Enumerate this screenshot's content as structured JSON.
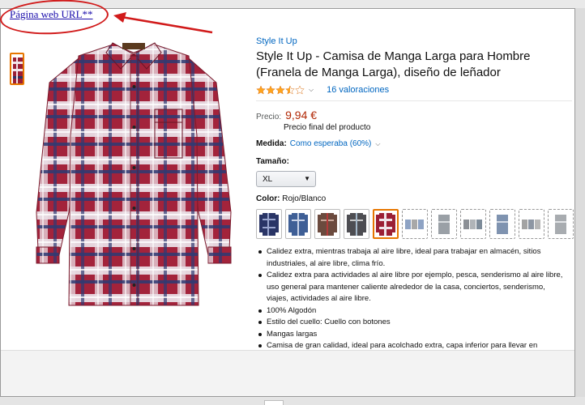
{
  "annotation": {
    "url_label": "Página web URL**",
    "highlight_color": "#d11a1a"
  },
  "product": {
    "brand": "Style It Up",
    "title": "Style It Up - Camisa de Manga Larga para Hombre (Franela de Manga Larga), diseño de leñador",
    "rating": {
      "stars": 3.5,
      "max": 5,
      "reviews_label": "16 valoraciones"
    },
    "price": {
      "label": "Precio:",
      "value": "9,94 €",
      "note": "Precio final del producto",
      "color": "#b12704"
    },
    "size_measure": {
      "label": "Medida:",
      "value": "Como esperaba (60%)"
    },
    "size": {
      "label": "Tamaño:",
      "selected": "XL"
    },
    "color": {
      "label": "Color:",
      "selected": "Rojo/Blanco"
    },
    "swatches": [
      {
        "name": "navy-plaid",
        "selected": false,
        "available": true
      },
      {
        "name": "blue-plaid",
        "selected": false,
        "available": true
      },
      {
        "name": "brown-plaid",
        "selected": false,
        "available": true
      },
      {
        "name": "grey-plaid",
        "selected": false,
        "available": true
      },
      {
        "name": "red-white-plaid",
        "selected": true,
        "available": true
      },
      {
        "name": "multi-pack-blue",
        "selected": false,
        "available": false
      },
      {
        "name": "grey-single",
        "selected": false,
        "available": false
      },
      {
        "name": "multi-pack-grey",
        "selected": false,
        "available": false
      },
      {
        "name": "blue-single",
        "selected": false,
        "available": false
      },
      {
        "name": "multi-pack-mixed",
        "selected": false,
        "available": false
      },
      {
        "name": "light-single",
        "selected": false,
        "available": false
      }
    ],
    "bullets": [
      "Calidez extra, mientras trabaja al aire libre, ideal para trabajar en almacén, sitios industriales, al aire libre, clima frío.",
      "Calidez extra para actividades al aire libre por ejemplo, pesca, senderismo al aire libre, uso general para mantener caliente alrededor de la casa, conciertos, senderismo, viajes, actividades al aire libre.",
      "100% Algodón",
      "Estilo del cuello: Cuello con botones",
      "Mangas largas",
      "Camisa de gran calidad, ideal para acolchado extra, capa inferior para llevar en"
    ]
  },
  "icons": {
    "star": "star-icon",
    "chevron": "chevron-down-icon",
    "arrow": "red-arrow-annotation"
  },
  "colors": {
    "link": "#0066c0",
    "selected_border": "#e77600",
    "plaid_red": "#9b1f35",
    "plaid_navy": "#2a3566"
  }
}
